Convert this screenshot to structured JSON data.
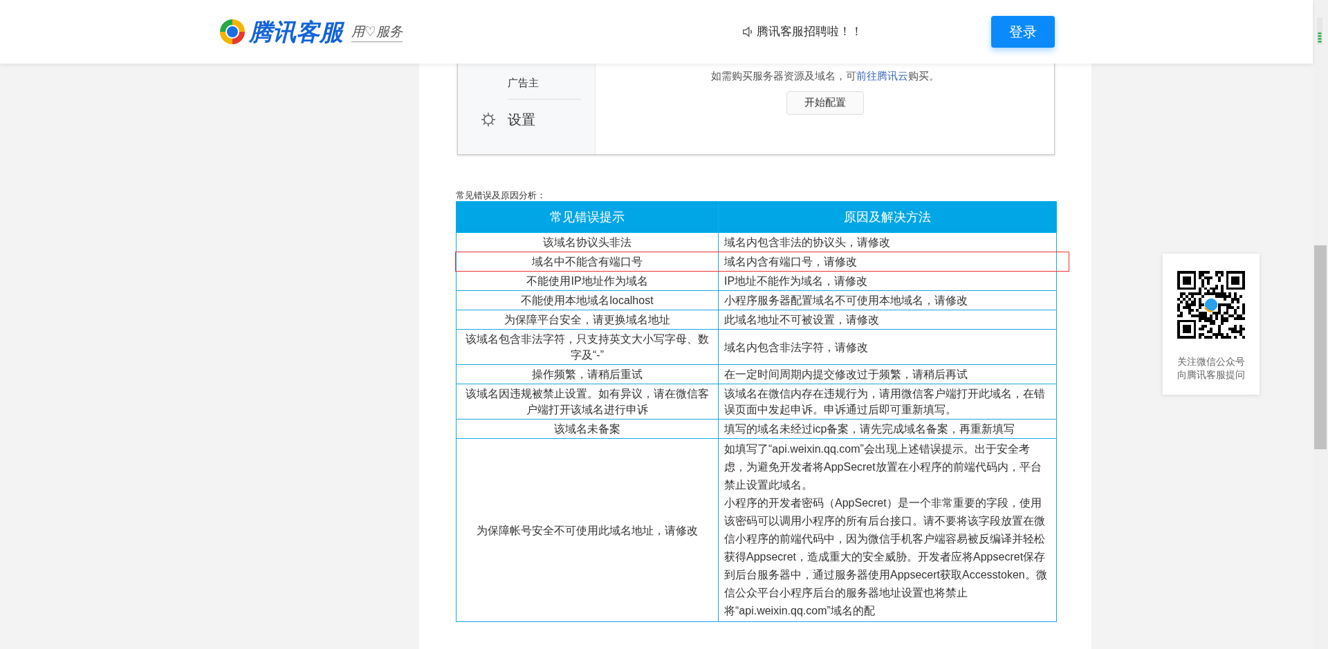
{
  "header": {
    "brand": "腾讯客服",
    "slogan": "用♡服务",
    "notice": "腾讯客服招聘啦！！",
    "login_button": "登录"
  },
  "embedded_screenshot": {
    "sidebar_items": [
      {
        "label": "广告主"
      }
    ],
    "settings_label": "设置",
    "hint": "如需购买服务器资源及域名，可**前往腾讯云**购买。",
    "start_button": "开始配置"
  },
  "table_caption": "常见错误及原因分析：",
  "table": {
    "columns": [
      "常见错误提示",
      "原因及解决方法"
    ],
    "rows": [
      {
        "cells": [
          "该域名协议头非法",
          "域名内包含非法的协议头，请修改"
        ],
        "highlighted": false
      },
      {
        "cells": [
          "域名中不能含有端口号",
          "域名内含有端口号，请修改"
        ],
        "highlighted": true
      },
      {
        "cells": [
          "不能使用IP地址作为域名",
          "IP地址不能作为域名，请修改"
        ],
        "highlighted": false
      },
      {
        "cells": [
          "不能使用本地域名localhost",
          "小程序服务器配置域名不可使用本地域名，请修改"
        ],
        "highlighted": false
      },
      {
        "cells": [
          "为保障平台安全，请更换域名地址",
          "此域名地址不可被设置，请修改"
        ],
        "highlighted": false
      },
      {
        "cells": [
          "该域名包含非法字符，只支持英文大小写字母、数字及“-”",
          "域名内包含非法字符，请修改"
        ],
        "highlighted": false
      },
      {
        "cells": [
          "操作频繁，请稍后重试",
          "在一定时间周期内提交修改过于频繁，请稍后再试"
        ],
        "highlighted": false
      },
      {
        "cells": [
          "该域名因违规被禁止设置。如有异议，请在微信客户端打开该域名进行申诉",
          "该域名在微信内存在违规行为，请用微信客户端打开此域名，在错误页面中发起申诉。申诉通过后即可重新填写。"
        ],
        "highlighted": false
      },
      {
        "cells": [
          "该域名未备案",
          "填写的域名未经过icp备案，请先完成域名备案，再重新填写"
        ],
        "highlighted": false
      },
      {
        "cells": [
          "为保障帐号安全不可使用此域名地址，请修改",
          [
            "如填写了“api.weixin.qq.com”会出现上述错误提示。出于安全考虑，为避免开发者将AppSecret放置在小程序的前端代码内，平台禁止设置此域名。",
            "小程序的开发者密码（AppSecret）是一个非常重要的字段，使用该密码可以调用小程序的所有后台接口。请不要将该字段放置在微信小程序的前端代码中，因为微信手机客户端容易被反编译并轻松获得Appsecret，造成重大的安全威胁。开发者应将Appsecret保存到后台服务器中，通过服务器使用Appsecert获取Accesstoken。微信公众平台小程序后台的服务器地址设置也将禁止将“api.weixin.qq.com”域名的配"
          ]
        ],
        "highlighted": false
      }
    ]
  },
  "qr_card": {
    "lines": [
      "关注微信公众号",
      "向腾讯客服提问"
    ]
  }
}
